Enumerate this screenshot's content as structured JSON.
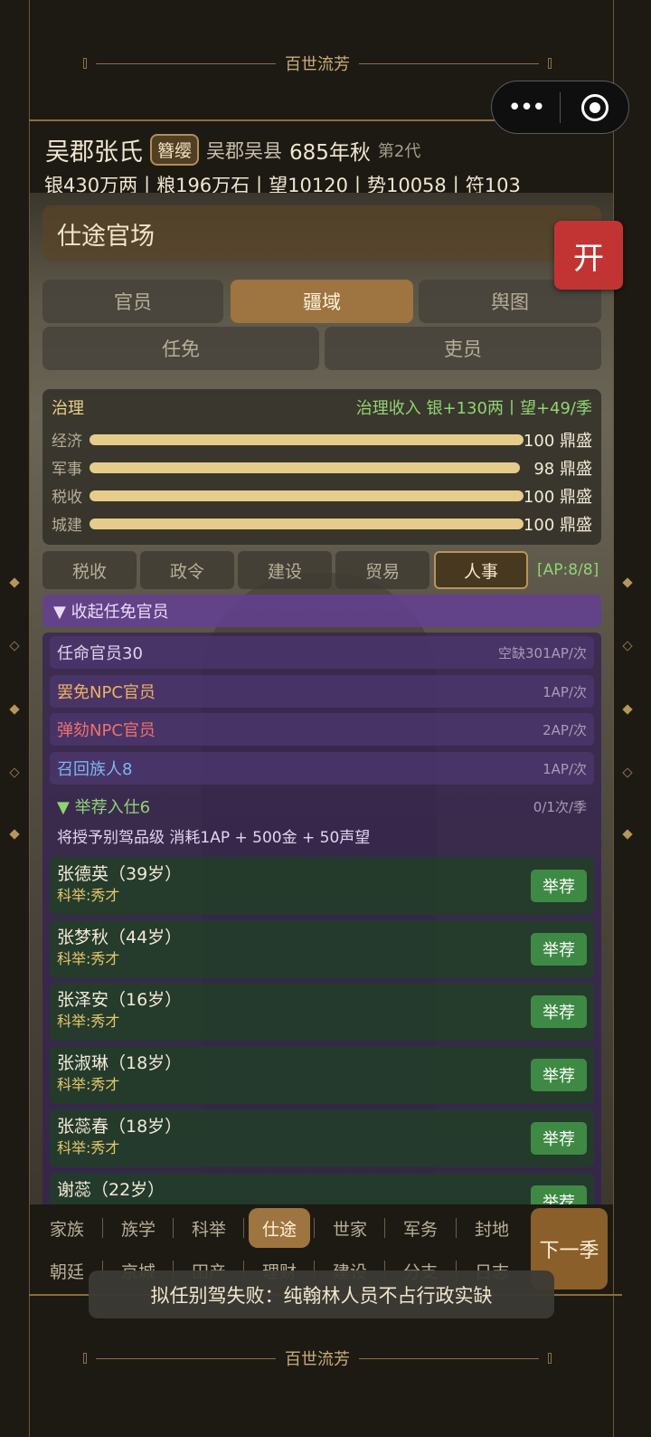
{
  "banner": {
    "text": "百世流芳"
  },
  "capsule": {
    "more_icon": "more-dots-icon",
    "close_icon": "target-icon"
  },
  "header": {
    "family": "吴郡张氏",
    "rank_badge": "簪缨",
    "location": "吴郡吴县",
    "year": "685年秋",
    "generation": "第2代",
    "resources": "银430万两丨粮196万石丨望10120丨势10058丨符103"
  },
  "panel": {
    "title": "仕途官场",
    "open_button": "开",
    "tabs": [
      "官员",
      "疆域",
      "舆图",
      "任免",
      "吏员"
    ],
    "active_tab": "疆域"
  },
  "governance": {
    "label": "治理",
    "income": "治理收入 银+130两丨望+49/季",
    "bars": [
      {
        "label": "经济",
        "value": 100,
        "text": "100 鼎盛"
      },
      {
        "label": "军事",
        "value": 98,
        "text": "98 鼎盛"
      },
      {
        "label": "税收",
        "value": 100,
        "text": "100 鼎盛"
      },
      {
        "label": "城建",
        "value": 100,
        "text": "100 鼎盛"
      }
    ]
  },
  "subtabs": {
    "items": [
      "税收",
      "政令",
      "建设",
      "贸易",
      "人事"
    ],
    "active": "人事",
    "ap": "[AP:8/8]"
  },
  "appoint": {
    "collapse_label": "▼ 收起任免官员",
    "actions": [
      {
        "label": "任命官员30",
        "cost": "空缺301AP/次",
        "color": "#e0d4ee"
      },
      {
        "label": "罢免NPC官员",
        "cost": "1AP/次",
        "color": "#f0b060"
      },
      {
        "label": "弹劾NPC官员",
        "cost": "2AP/次",
        "color": "#f07070"
      },
      {
        "label": "召回族人8",
        "cost": "1AP/次",
        "color": "#7fb6f0"
      }
    ],
    "recommend_header": "▼ 举荐入仕6",
    "recommend_limit": "0/1次/季",
    "recommend_note": "将授予别驾品级  消耗1AP + 500金 + 50声望",
    "recommend_button": "举荐",
    "candidates": [
      {
        "name": "张德英（39岁）",
        "desc": "科举:秀才"
      },
      {
        "name": "张梦秋（44岁）",
        "desc": "科举:秀才"
      },
      {
        "name": "张泽安（16岁）",
        "desc": "科举:秀才"
      },
      {
        "name": "张淑琳（18岁）",
        "desc": "科举:秀才"
      },
      {
        "name": "张蕊春（18岁）",
        "desc": "科举:秀才"
      },
      {
        "name": "谢蕊（22岁）",
        "desc": ""
      }
    ]
  },
  "bottom_nav": {
    "row1": [
      "家族",
      "族学",
      "科举",
      "仕途",
      "世家",
      "军务",
      "封地"
    ],
    "row2": [
      "朝廷",
      "京城",
      "田产",
      "理财",
      "建设",
      "分支",
      "日志"
    ],
    "active": "仕途",
    "next_button": "下一季"
  },
  "toast": "拟任别驾失败：纯翰林人员不占行政实缺"
}
